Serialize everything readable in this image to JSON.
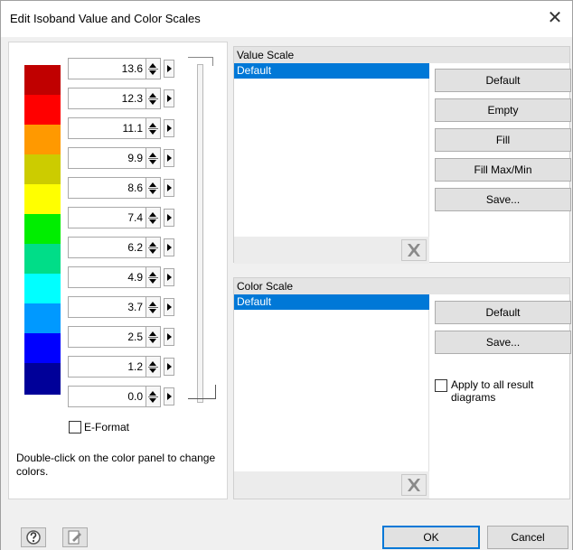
{
  "window": {
    "title": "Edit Isoband Value and Color Scales",
    "close_glyph": "✕"
  },
  "isobands": [
    {
      "value": "13.6",
      "color": "#c00000"
    },
    {
      "value": "12.3",
      "color": "#ff0000"
    },
    {
      "value": "11.1",
      "color": "#ff9900"
    },
    {
      "value": "9.9",
      "color": "#cccc00"
    },
    {
      "value": "8.6",
      "color": "#ffff00"
    },
    {
      "value": "7.4",
      "color": "#00ee00"
    },
    {
      "value": "6.2",
      "color": "#00dd88"
    },
    {
      "value": "4.9",
      "color": "#00ffff"
    },
    {
      "value": "3.7",
      "color": "#0099ff"
    },
    {
      "value": "2.5",
      "color": "#0000ff"
    },
    {
      "value": "1.2",
      "color": "#000099"
    },
    {
      "value": "0.0"
    }
  ],
  "e_format": {
    "label": "E-Format",
    "checked": false
  },
  "hint": "Double-click on the color panel to change colors.",
  "value_scale": {
    "header": "Value Scale",
    "items": [
      "Default"
    ],
    "selected": "Default",
    "buttons": [
      "Default",
      "Empty",
      "Fill",
      "Fill Max/Min",
      "Save..."
    ]
  },
  "color_scale": {
    "header": "Color Scale",
    "items": [
      "Default"
    ],
    "selected": "Default",
    "buttons": [
      "Default",
      "Save..."
    ],
    "apply_all_label": "Apply to all result diagrams",
    "apply_all_checked": false
  },
  "footer": {
    "ok": "OK",
    "cancel": "Cancel"
  }
}
